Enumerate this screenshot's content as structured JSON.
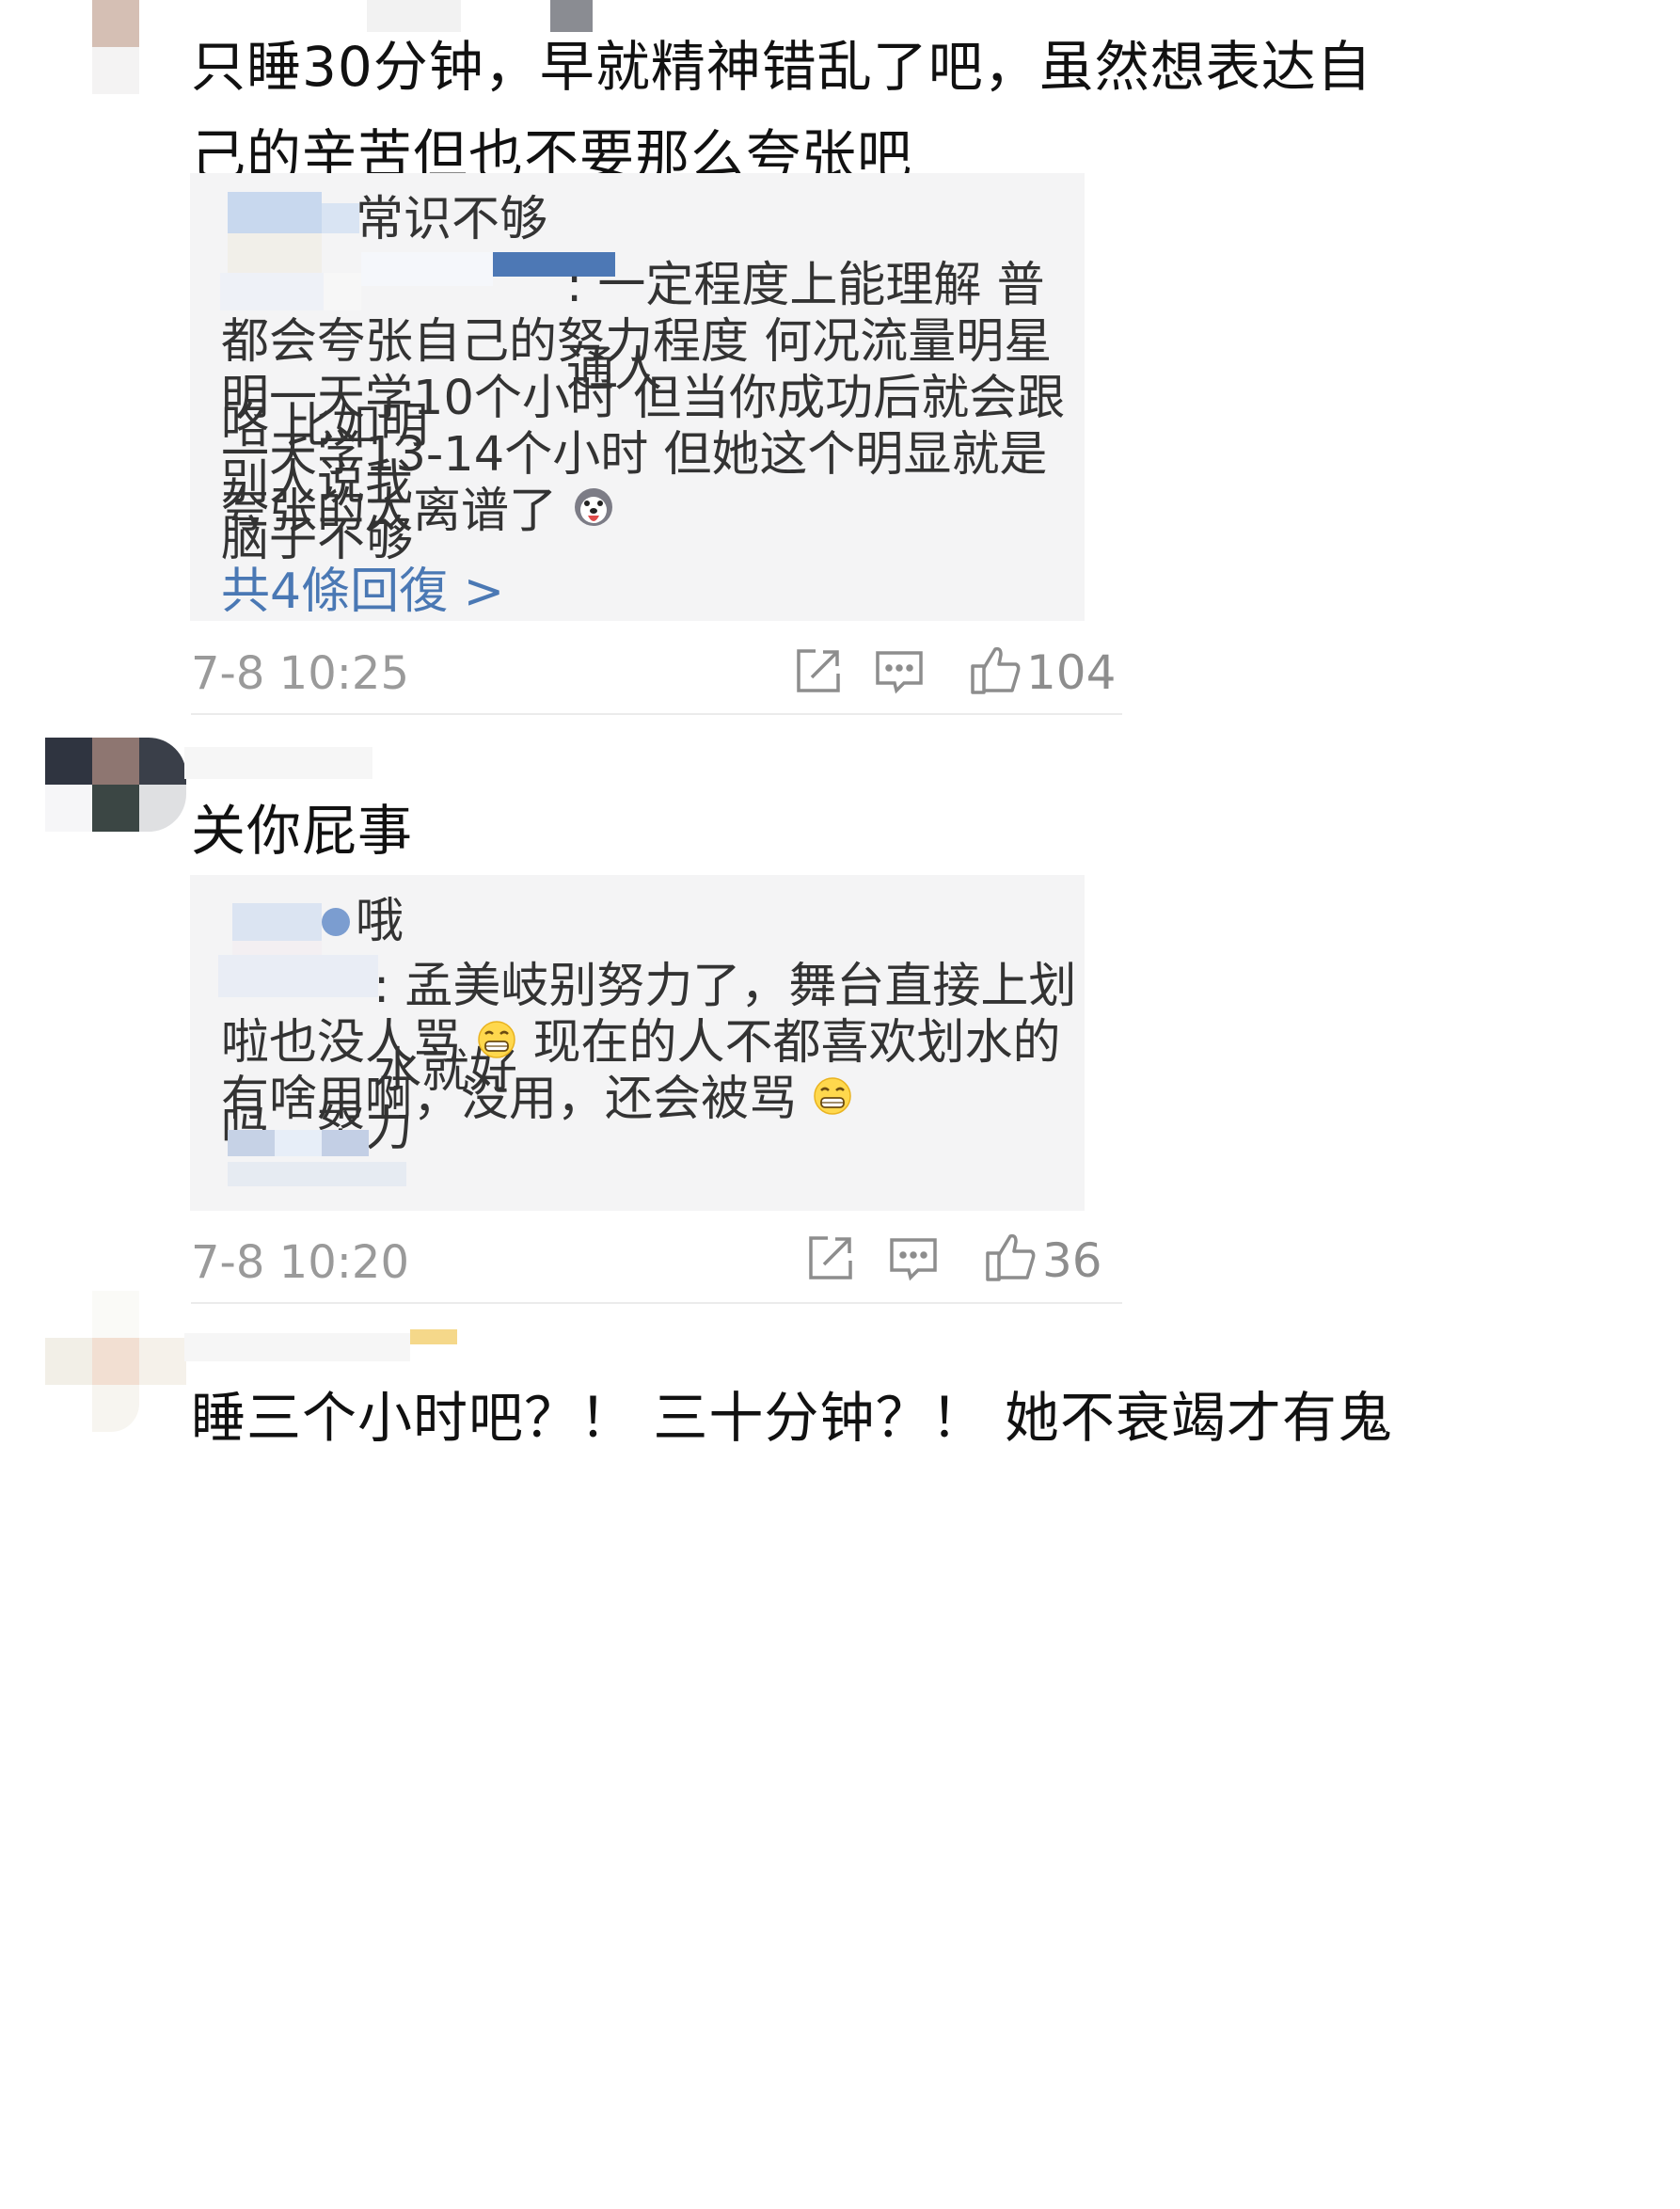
{
  "comments": [
    {
      "text_lines": [
        "只睡30分钟，早就精神错乱了吧，虽然想表达自",
        "己的辛苦但也不要那么夸张吧"
      ],
      "replies": [
        {
          "line": "常识不够"
        },
        {
          "lines": [
            ": 一定程度上能理解 普通人",
            "都会夸张自己的努力程度 何况流量明星咯 比如明",
            "明一天学10个小时 但当你成功后就会跟别人说我",
            "一天学13-14个小时 但她这个明显就是脑子不够",
            "夸张的太离谱了"
          ]
        }
      ],
      "more_replies": "共4條回復 >",
      "time": "7-8 10:25",
      "like_count": "104"
    },
    {
      "text_lines": [
        "关你屁事"
      ],
      "replies": [
        {
          "line": "哦"
        },
        {
          "lines": [
            ": 孟美岐别努力了，舞台直接上划水就好",
            "啦也没人骂",
            "现在的人不都喜欢划水的吗，努力",
            "有啥用啊，没用，还会被骂"
          ]
        }
      ],
      "time": "7-8 10:20",
      "like_count": "36"
    },
    {
      "text_lines": [
        "睡三个小时吧？！ 三十分钟？！ 她不衰竭才有鬼"
      ]
    }
  ],
  "icons": {
    "share": "share-icon",
    "comment": "comment-icon",
    "like": "thumbs-up-icon",
    "husky": "husky-emoji-icon",
    "grin": "grin-emoji-icon"
  },
  "colors": {
    "link": "#4a78b4",
    "reply_bg": "#f4f4f5",
    "meta": "#9a9a9a"
  }
}
